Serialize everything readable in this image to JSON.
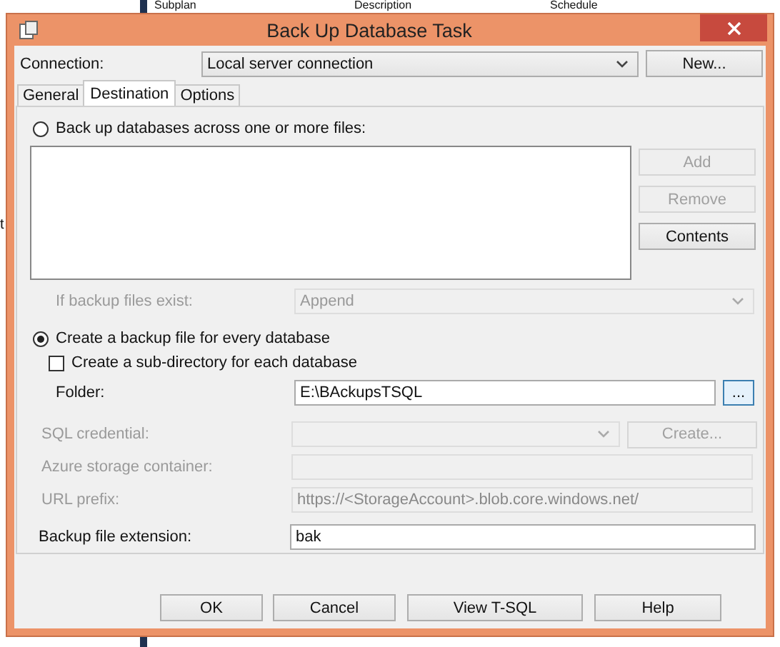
{
  "background": {
    "columns": [
      "Subplan",
      "Description",
      "Schedule"
    ],
    "side_text": "t"
  },
  "window": {
    "title": "Back Up Database Task"
  },
  "connection": {
    "label": "Connection:",
    "value": "Local server connection",
    "new_button": "New..."
  },
  "tabs": [
    {
      "label": "General",
      "selected": false
    },
    {
      "label": "Destination",
      "selected": true
    },
    {
      "label": "Options",
      "selected": false
    }
  ],
  "destination": {
    "options": [
      {
        "label": "Back up databases across one or more files:",
        "selected": false
      },
      {
        "label": "Create a backup file for every database",
        "selected": true
      }
    ],
    "file_buttons": [
      {
        "label": "Add",
        "disabled": true
      },
      {
        "label": "Remove",
        "disabled": true
      },
      {
        "label": "Contents",
        "disabled": false
      }
    ],
    "if_exists": {
      "label": "If backup files exist:",
      "value": "Append",
      "disabled": true
    },
    "subdirectory": {
      "label": "Create a sub-directory for each database",
      "checked": false
    },
    "folder": {
      "label": "Folder:",
      "value": "E:\\BAckupsTSQL",
      "browse_button": "..."
    },
    "sql_credential": {
      "label": "SQL credential:",
      "disabled": true,
      "create_button": "Create..."
    },
    "azure_container": {
      "label": "Azure storage container:",
      "disabled": true
    },
    "url_prefix": {
      "label": "URL prefix:",
      "value": "https://<StorageAccount>.blob.core.windows.net/",
      "disabled": true
    },
    "extension": {
      "label": "Backup file extension:",
      "value": "bak"
    }
  },
  "buttons": [
    "OK",
    "Cancel",
    "View T-SQL",
    "Help"
  ]
}
